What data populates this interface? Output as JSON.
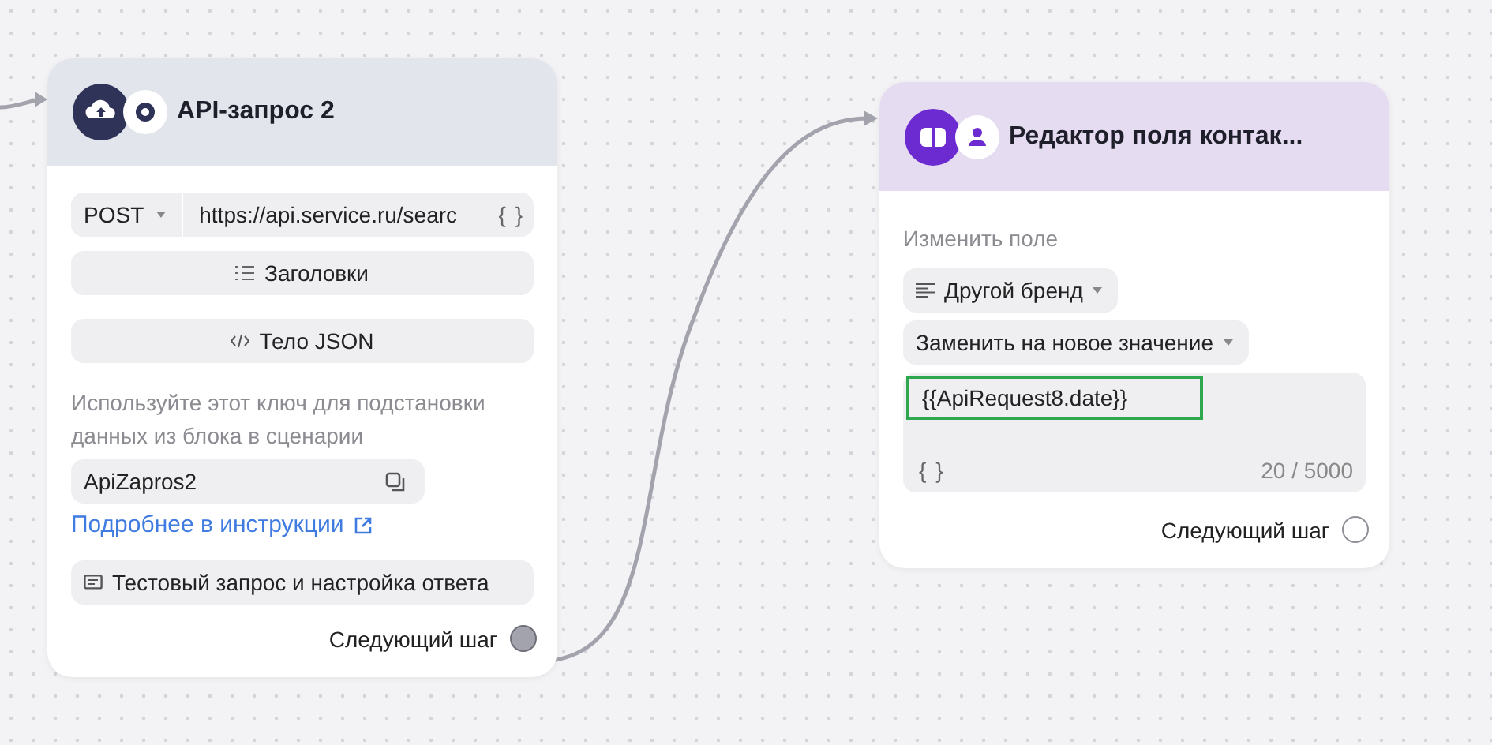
{
  "nodes": [
    {
      "kind": "api",
      "title": "API-запрос 2",
      "method": "POST",
      "url": "https://api.service.ru/searc",
      "url_brace": "{ }",
      "headers_button": "Заголовки",
      "body_button": "Тело JSON",
      "hint": "Используйте этот ключ для подстановки данных из блока в сценарии",
      "key": "ApiZapros2",
      "link": "Подробнее в инструкции",
      "test_button": "Тестовый запрос и настройка ответа",
      "next_step": {
        "label": "Следующий шаг",
        "connected": true
      }
    },
    {
      "kind": "field_editor",
      "title": "Редактор поля контак...",
      "field_label": "Изменить поле",
      "field": "Другой бренд",
      "action": "Заменить на новое значение",
      "value": "{{ApiRequest8.date}}",
      "value_highlighted": true,
      "brace": "{ }",
      "counter": "20 / 5000",
      "next_step": {
        "label": "Следующий шаг",
        "connected": false
      }
    }
  ]
}
